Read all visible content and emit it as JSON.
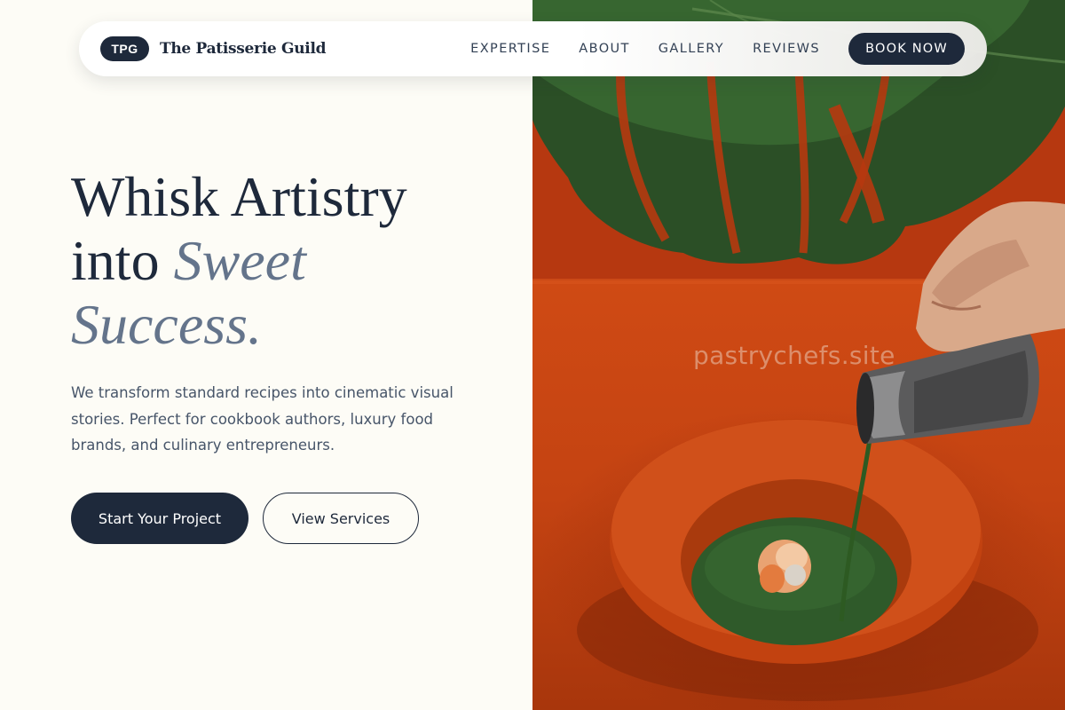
{
  "nav": {
    "logo_badge": "TPG",
    "brand_name": "The Patisserie Guild",
    "links": [
      "EXPERTISE",
      "ABOUT",
      "GALLERY",
      "REVIEWS"
    ],
    "cta_label": "BOOK NOW"
  },
  "hero": {
    "headline_line1": "Whisk Artistry",
    "headline_line2_plain": "into ",
    "headline_line2_accent": "Sweet",
    "headline_line3_accent": "Success.",
    "subtext": "We transform standard recipes into cinematic visual stories. Perfect for cookbook authors, luxury food brands, and culinary entrepreneurs.",
    "primary_button": "Start Your Project",
    "secondary_button": "View Services"
  },
  "image": {
    "watermark": "pastrychefs.site"
  },
  "colors": {
    "background": "#fdfcf6",
    "navy": "#1e293b",
    "accent_slate": "#64748b",
    "body_text": "#475569",
    "image_orange": "#c4410f",
    "leaf_green": "#2e5a2c",
    "soup_green": "#2f5a2a"
  }
}
